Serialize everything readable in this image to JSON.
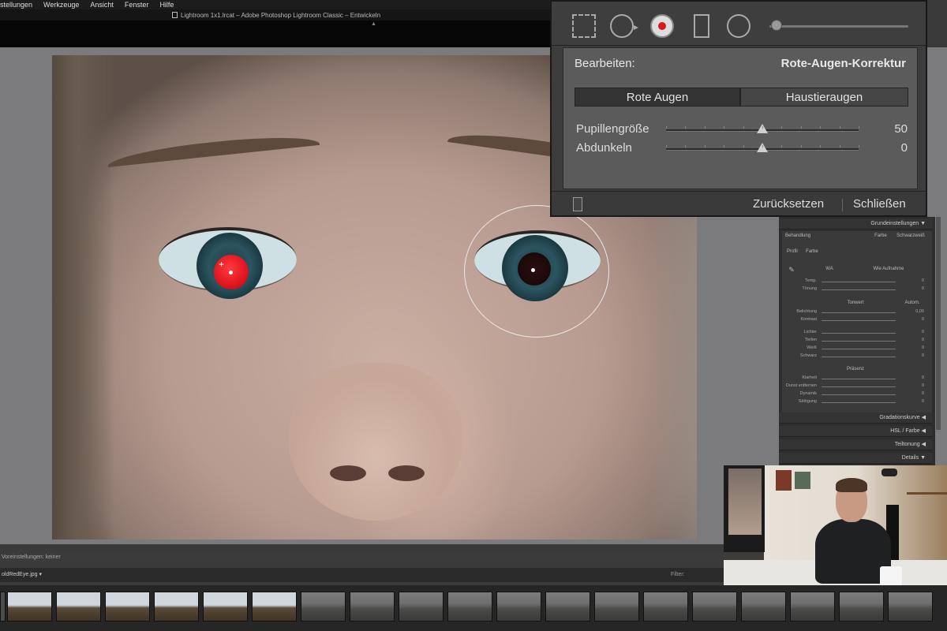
{
  "menubar": {
    "items": [
      "stellungen",
      "Werkzeuge",
      "Ansicht",
      "Fenster",
      "Hilfe"
    ]
  },
  "window": {
    "title": "Lightroom 1x1.lrcat – Adobe Photoshop Lightroom Classic – Entwickeln"
  },
  "redeye_panel": {
    "edit_label": "Bearbeiten:",
    "edit_value": "Rote-Augen-Korrektur",
    "modes": [
      "Rote Augen",
      "Haustieraugen"
    ],
    "active_mode": "Rote Augen",
    "sliders": [
      {
        "label": "Pupillengröße",
        "value": "50",
        "level": 0.5
      },
      {
        "label": "Abdunkeln",
        "value": "0",
        "level": 0.5
      }
    ],
    "reset_label": "Zurücksetzen",
    "close_label": "Schließen"
  },
  "develop_panel": {
    "basic_header": "Grundeinstellungen",
    "treatment_label": "Behandlung",
    "treatment_options": [
      "Farbe",
      "Schwarzweiß"
    ],
    "profile_label": "Profil",
    "profile_value": "Farbe",
    "wb_label": "WA",
    "wb_value": "Wie Aufnahme",
    "wb_rows": [
      {
        "label": "Temp.",
        "value": "0"
      },
      {
        "label": "Tönung",
        "value": "0"
      }
    ],
    "tone_label": "Tonwert",
    "tone_auto": "Autom.",
    "tone_rows": [
      {
        "label": "Belichtung",
        "value": "0,00"
      },
      {
        "label": "Kontrast",
        "value": "0"
      },
      {
        "label": "Lichter",
        "value": "0"
      },
      {
        "label": "Tiefen",
        "value": "0"
      },
      {
        "label": "Weiß",
        "value": "0"
      },
      {
        "label": "Schwarz",
        "value": "0"
      }
    ],
    "presence_label": "Präsenz",
    "presence_rows": [
      {
        "label": "Klarheit",
        "value": "0"
      },
      {
        "label": "Dunst entfernen",
        "value": "0"
      },
      {
        "label": "Dynamik",
        "value": "0"
      },
      {
        "label": "Sättigung",
        "value": "0"
      }
    ],
    "collapsed_sections": [
      "Gradationskurve",
      "HSL / Farbe",
      "Teiltonung",
      "Details"
    ]
  },
  "statusbar": {
    "text": "Voreinstellungen: keiner"
  },
  "filmstrip": {
    "filename": "oldRedEye.jpg",
    "filter_label": "Filter:"
  },
  "colors": {
    "panel_bg": "#3c3c3c",
    "panel_body": "#5b5b5b",
    "red_pupil": "#e0151f"
  }
}
